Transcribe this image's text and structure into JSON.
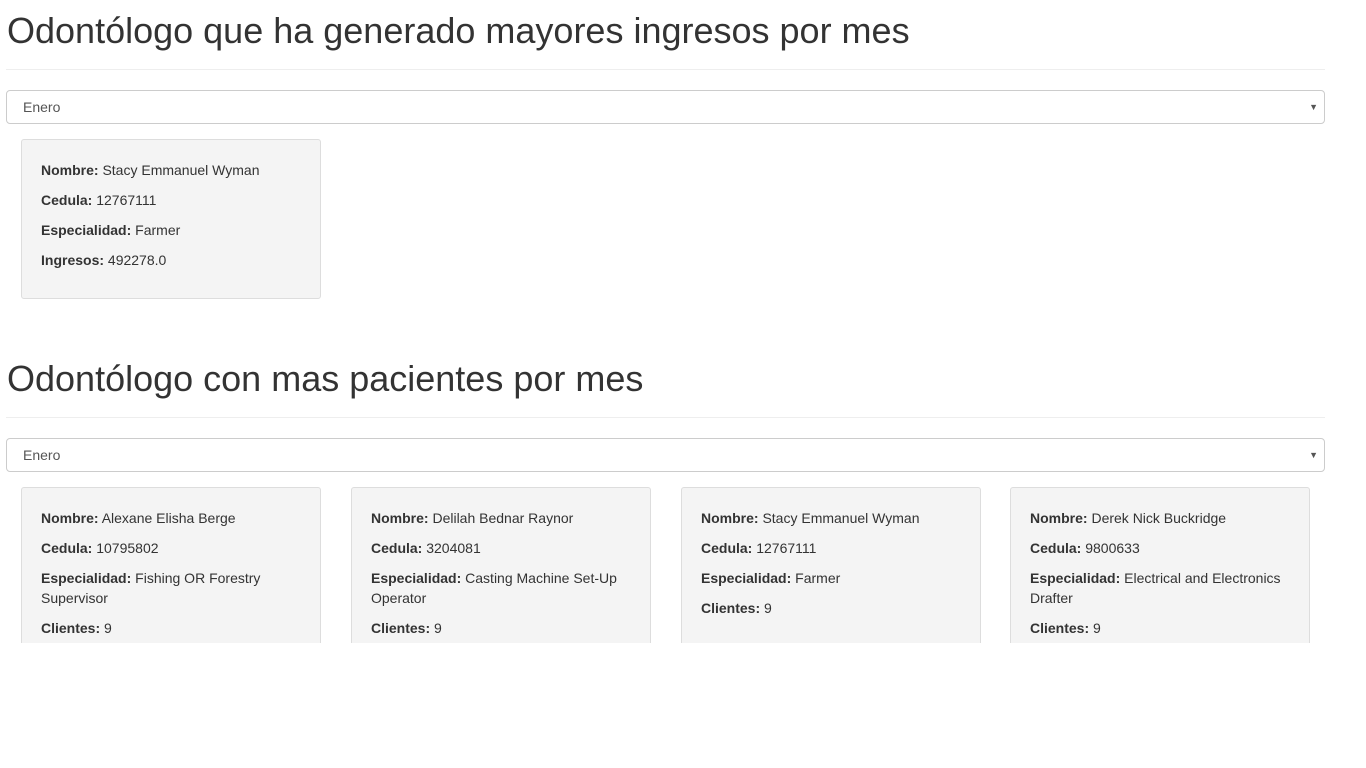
{
  "section1": {
    "title": "Odontólogo que ha generado mayores ingresos por mes",
    "month": "Enero",
    "card": {
      "labels": {
        "nombre": "Nombre:",
        "cedula": "Cedula:",
        "especialidad": "Especialidad:",
        "ingresos": "Ingresos:"
      },
      "nombre": "Stacy Emmanuel Wyman",
      "cedula": "12767111",
      "especialidad": "Farmer",
      "ingresos": "492278.0"
    }
  },
  "section2": {
    "title": "Odontólogo con mas pacientes por mes",
    "month": "Enero",
    "labels": {
      "nombre": "Nombre:",
      "cedula": "Cedula:",
      "especialidad": "Especialidad:",
      "clientes": "Clientes:"
    },
    "cards": [
      {
        "nombre": "Alexane Elisha Berge",
        "cedula": "10795802",
        "especialidad": "Fishing OR Forestry Supervisor",
        "clientes": "9"
      },
      {
        "nombre": "Delilah Bednar Raynor",
        "cedula": "3204081",
        "especialidad": "Casting Machine Set-Up Operator",
        "clientes": "9"
      },
      {
        "nombre": "Stacy Emmanuel Wyman",
        "cedula": "12767111",
        "especialidad": "Farmer",
        "clientes": "9"
      },
      {
        "nombre": "Derek Nick Buckridge",
        "cedula": "9800633",
        "especialidad": "Electrical and Electronics Drafter",
        "clientes": "9"
      }
    ]
  }
}
